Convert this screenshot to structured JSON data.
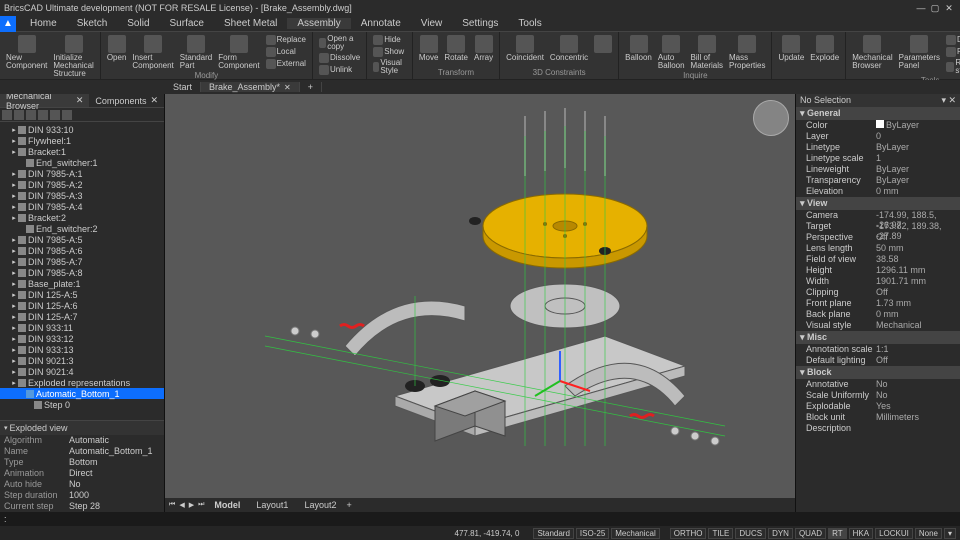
{
  "titlebar": {
    "text": "BricsCAD Ultimate development (NOT FOR RESALE License) - [Brake_Assembly.dwg]"
  },
  "ribbon_tabs": [
    "Home",
    "Sketch",
    "Solid",
    "Surface",
    "Sheet Metal",
    "Assembly",
    "Annotate",
    "View",
    "Settings",
    "Tools"
  ],
  "ribbon_active": "Assembly",
  "ribbon_groups": [
    {
      "label": "",
      "buttons": [
        {
          "label": "New\nComponent",
          "name": "new-component"
        },
        {
          "label": "Initialize Mechanical\nStructure",
          "name": "init-mech-structure"
        }
      ]
    },
    {
      "label": "",
      "buttons": [
        {
          "label": "Open",
          "name": "open"
        },
        {
          "label": "Insert\nComponent",
          "name": "insert-component"
        },
        {
          "label": "Standard\nPart",
          "name": "standard-part"
        },
        {
          "label": "Form\nComponent",
          "name": "form-component"
        }
      ],
      "small": [
        {
          "label": "Replace",
          "name": "replace"
        },
        {
          "label": "Local",
          "name": "set-local"
        },
        {
          "label": "External",
          "name": "set-external"
        }
      ],
      "small_label": "Modify"
    },
    {
      "label": "",
      "small": [
        {
          "label": "Open a copy",
          "name": "open-copy"
        },
        {
          "label": "Dissolve",
          "name": "dissolve"
        },
        {
          "label": "Unlink",
          "name": "unlink"
        }
      ]
    },
    {
      "label": "",
      "small": [
        {
          "label": "Hide",
          "name": "hide"
        },
        {
          "label": "Show",
          "name": "show"
        },
        {
          "label": "Visual Style",
          "name": "visual-style"
        }
      ]
    },
    {
      "label": "Transform",
      "buttons": [
        {
          "label": "Move",
          "name": "move"
        },
        {
          "label": "Rotate",
          "name": "rotate"
        },
        {
          "label": "Array",
          "name": "array"
        }
      ]
    },
    {
      "label": "3D Constraints",
      "buttons": [
        {
          "label": "Coincident",
          "name": "coincident"
        },
        {
          "label": "Concentric",
          "name": "concentric"
        },
        {
          "label": "",
          "name": "constraint-more"
        }
      ]
    },
    {
      "label": "Inquire",
      "buttons": [
        {
          "label": "Balloon",
          "name": "balloon"
        },
        {
          "label": "Auto\nBalloon",
          "name": "auto-balloon"
        },
        {
          "label": "Bill of\nMaterials",
          "name": "bom"
        },
        {
          "label": "Mass\nProperties",
          "name": "mass-props"
        }
      ]
    },
    {
      "label": "",
      "buttons": [
        {
          "label": "Update",
          "name": "update"
        },
        {
          "label": "Explode",
          "name": "explode"
        }
      ]
    },
    {
      "label": "Tools",
      "buttons": [
        {
          "label": "Mechanical\nBrowser",
          "name": "mech-browser"
        },
        {
          "label": "Parameters\nPanel",
          "name": "params-panel"
        }
      ],
      "small": [
        {
          "label": "Dependencies",
          "name": "dependencies"
        },
        {
          "label": "Recover",
          "name": "recover"
        },
        {
          "label": "Remove structure",
          "name": "remove-structure"
        }
      ]
    }
  ],
  "doc_tabs": [
    {
      "label": "Start",
      "close": false
    },
    {
      "label": "Brake_Assembly*",
      "close": true,
      "active": true
    }
  ],
  "panel_tabs": [
    {
      "label": "Mechanical Browser",
      "active": true,
      "close": true
    },
    {
      "label": "Components",
      "close": true
    }
  ],
  "tree": [
    {
      "d": 1,
      "t": "▪",
      "i": "part",
      "label": "DIN 933:10"
    },
    {
      "d": 1,
      "t": "▪",
      "i": "part",
      "label": "Flywheel:1"
    },
    {
      "d": 1,
      "t": "▪",
      "i": "asm",
      "label": "Bracket:1"
    },
    {
      "d": 2,
      "t": " ",
      "i": "part",
      "label": "End_switcher:1"
    },
    {
      "d": 1,
      "t": "▪",
      "i": "part",
      "label": "DIN 7985-A:1"
    },
    {
      "d": 1,
      "t": "▪",
      "i": "part",
      "label": "DIN 7985-A:2"
    },
    {
      "d": 1,
      "t": "▪",
      "i": "part",
      "label": "DIN 7985-A:3"
    },
    {
      "d": 1,
      "t": "▪",
      "i": "part",
      "label": "DIN 7985-A:4"
    },
    {
      "d": 1,
      "t": "▪",
      "i": "asm",
      "label": "Bracket:2"
    },
    {
      "d": 2,
      "t": " ",
      "i": "part",
      "label": "End_switcher:2"
    },
    {
      "d": 1,
      "t": "▪",
      "i": "part",
      "label": "DIN 7985-A:5"
    },
    {
      "d": 1,
      "t": "▪",
      "i": "part",
      "label": "DIN 7985-A:6"
    },
    {
      "d": 1,
      "t": "▪",
      "i": "part",
      "label": "DIN 7985-A:7"
    },
    {
      "d": 1,
      "t": "▪",
      "i": "part",
      "label": "DIN 7985-A:8"
    },
    {
      "d": 1,
      "t": "▪",
      "i": "part",
      "label": "Base_plate:1"
    },
    {
      "d": 1,
      "t": "▪",
      "i": "part",
      "label": "DIN 125-A:5"
    },
    {
      "d": 1,
      "t": "▪",
      "i": "part",
      "label": "DIN 125-A:6"
    },
    {
      "d": 1,
      "t": "▪",
      "i": "part",
      "label": "DIN 125-A:7"
    },
    {
      "d": 1,
      "t": "▪",
      "i": "part",
      "label": "DIN 933:11"
    },
    {
      "d": 1,
      "t": "▪",
      "i": "part",
      "label": "DIN 933:12"
    },
    {
      "d": 1,
      "t": "▪",
      "i": "part",
      "label": "DIN 933:13"
    },
    {
      "d": 1,
      "t": "▪",
      "i": "part",
      "label": "DIN 9021:3"
    },
    {
      "d": 1,
      "t": "▪",
      "i": "part",
      "label": "DIN 9021:4"
    },
    {
      "d": 1,
      "t": "▪",
      "i": "fold",
      "label": "Exploded representations"
    },
    {
      "d": 2,
      "t": " ",
      "i": "anim",
      "label": "Automatic_Bottom_1",
      "sel": true
    },
    {
      "d": 3,
      "t": " ",
      "i": "step",
      "label": "Step 0"
    }
  ],
  "exploded": {
    "title": "Exploded view",
    "rows": [
      {
        "label": "Algorithm",
        "value": "Automatic"
      },
      {
        "label": "Name",
        "value": "Automatic_Bottom_1"
      },
      {
        "label": "Type",
        "value": "Bottom"
      },
      {
        "label": "Animation",
        "value": "Direct"
      },
      {
        "label": "Auto hide",
        "value": "No"
      },
      {
        "label": "Step duration",
        "value": "1000"
      },
      {
        "label": "Current step",
        "value": "Step 28"
      }
    ]
  },
  "layout": {
    "tabs": [
      "Model",
      "Layout1",
      "Layout2"
    ],
    "active": "Model"
  },
  "props": {
    "header": "No Selection",
    "sections": [
      {
        "name": "General",
        "rows": [
          {
            "label": "Color",
            "value": "ByLayer",
            "swatch": true
          },
          {
            "label": "Layer",
            "value": "0"
          },
          {
            "label": "Linetype",
            "value": "ByLayer",
            "line": true
          },
          {
            "label": "Linetype scale",
            "value": "1"
          },
          {
            "label": "Lineweight",
            "value": "ByLayer",
            "line": true
          },
          {
            "label": "Transparency",
            "value": "ByLayer"
          },
          {
            "label": "Elevation",
            "value": "0 mm"
          }
        ]
      },
      {
        "name": "View",
        "rows": [
          {
            "label": "Camera",
            "value": "-174.99, 188.5, -26.97"
          },
          {
            "label": "Target",
            "value": "-173.82, 189.38, -27.89"
          },
          {
            "label": "Perspective",
            "value": "Off"
          },
          {
            "label": "Lens length",
            "value": "50 mm"
          },
          {
            "label": "Field of view",
            "value": "38.58"
          },
          {
            "label": "Height",
            "value": "1296.11 mm"
          },
          {
            "label": "Width",
            "value": "1901.71 mm"
          },
          {
            "label": "Clipping",
            "value": "Off"
          },
          {
            "label": "Front plane",
            "value": "1.73 mm"
          },
          {
            "label": "Back plane",
            "value": "0 mm"
          },
          {
            "label": "Visual style",
            "value": "Mechanical"
          }
        ]
      },
      {
        "name": "Misc",
        "rows": [
          {
            "label": "Annotation scale",
            "value": "1:1"
          },
          {
            "label": "Default lighting",
            "value": "Off"
          }
        ]
      },
      {
        "name": "Block",
        "rows": [
          {
            "label": "Annotative",
            "value": "No"
          },
          {
            "label": "Scale Uniformly",
            "value": "No"
          },
          {
            "label": "Explodable",
            "value": "Yes"
          },
          {
            "label": "Block unit",
            "value": "Millimeters"
          },
          {
            "label": "Description",
            "value": ""
          }
        ]
      }
    ]
  },
  "cmdline": {
    "prompt": ":"
  },
  "status": {
    "coords": "477.81, -419.74, 0",
    "left_segs": [
      "Standard",
      "ISO-25",
      "Mechanical"
    ],
    "toggles": [
      "ORTHO",
      "TILE",
      "DUCS",
      "DYN",
      "QUAD",
      "RT",
      "HKA",
      "LOCKUI"
    ],
    "right": "None"
  }
}
